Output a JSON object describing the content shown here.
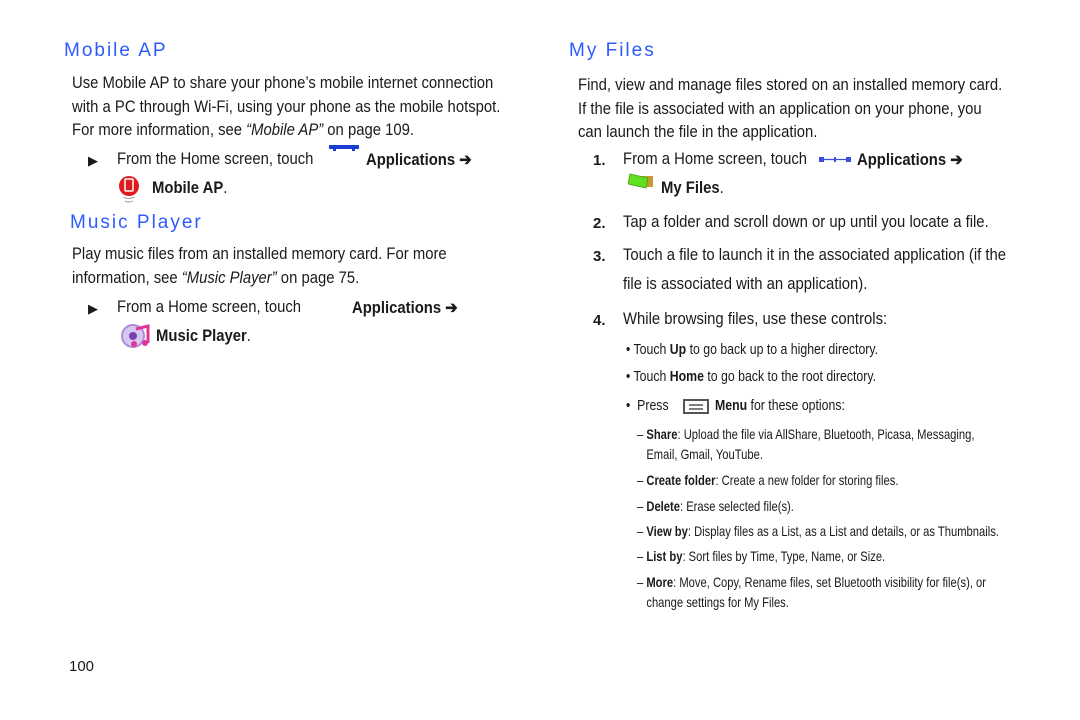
{
  "left": {
    "mobile_ap": {
      "heading": "Mobile AP",
      "para_lines": [
        "Use Mobile AP to share your phone’s mobile internet connection",
        "with a PC through Wi-Fi, using your phone as the mobile hotspot."
      ],
      "para_line3_pre": "For more information, see ",
      "para_line3_ref": "“Mobile AP”",
      "para_line3_post": " on page 109.",
      "step_pre": "From the Home screen, touch",
      "step_apps": "Applications ➔",
      "step_target": "Mobile AP",
      "step_end": "."
    },
    "music_player": {
      "heading": "Music Player",
      "para_line1": "Play music files from an installed memory card. For more",
      "para_line2_pre": "information, see ",
      "para_line2_ref": "“Music Player”",
      "para_line2_post": " on page 75.",
      "step_pre": "From a Home screen, touch",
      "step_apps": "Applications ➔",
      "step_target": "Music Player",
      "step_end": "."
    }
  },
  "right": {
    "my_files": {
      "heading": "My Files",
      "para_lines": [
        "Find, view and manage files stored on an installed memory card.",
        "If the file is associated with an application on your phone, you",
        "can launch the file in the application."
      ],
      "steps": [
        {
          "num": "1.",
          "pre": "From a Home screen, touch",
          "apps": "Applications ➔",
          "target": "My Files",
          "end": "."
        },
        {
          "num": "2.",
          "text": "Tap a folder and scroll down or up until you locate a file."
        },
        {
          "num": "3.",
          "text_line1": "Touch a file to launch it in the associated application (if the",
          "text_line2": "file is associated with an application)."
        },
        {
          "num": "4.",
          "text": "While browsing files, use these controls:"
        }
      ],
      "bullets": [
        {
          "pre": "Touch ",
          "bold": "Up",
          "post": " to go back up to a higher directory."
        },
        {
          "pre": "Touch ",
          "bold": "Home",
          "post": " to go back to the root directory."
        },
        {
          "pre": "Press ",
          "bold": "Menu",
          "post": " for these options:"
        }
      ],
      "options": [
        {
          "bold": "Share",
          "line1": ": Upload the file via AllShare, Bluetooth, Picasa, Messaging,",
          "line2": "Email, Gmail, YouTube."
        },
        {
          "bold": "Create folder",
          "line1": ": Create a new folder for storing files."
        },
        {
          "bold": "Delete",
          "line1": ": Erase selected file(s)."
        },
        {
          "bold": "View by",
          "line1": ":  Display files as a List, as a List and details, or as Thumbnails."
        },
        {
          "bold": "List by",
          "line1": ": Sort files by Time, Type, Name, or Size."
        },
        {
          "bold": "More",
          "line1": ": Move, Copy, Rename files, set Bluetooth visibility for file(s), or",
          "line2": "change settings for My Files."
        }
      ]
    }
  },
  "footer": {
    "page_number": "100"
  },
  "colors": {
    "heading": "#2e5bff"
  }
}
